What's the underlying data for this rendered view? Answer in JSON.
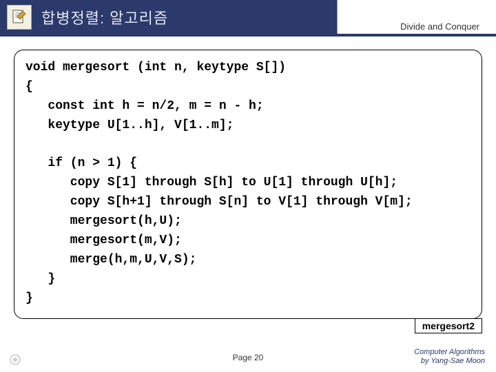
{
  "header": {
    "title": "합병정렬: 알고리즘",
    "subtitle": "Divide and Conquer"
  },
  "code": "void mergesort (int n, keytype S[])\n{\n   const int h = n/2, m = n - h;\n   keytype U[1..h], V[1..m];\n\n   if (n > 1) {\n      copy S[1] through S[h] to U[1] through U[h];\n      copy S[h+1] through S[n] to V[1] through V[m];\n      mergesort(h,U);\n      mergesort(m,V);\n      merge(h,m,U,V,S);\n   }\n}",
  "tag": "mergesort2",
  "footer": {
    "page": "Page 20",
    "credits_line1": "Computer Algorithms",
    "credits_line2": "by Yang-Sae Moon"
  }
}
